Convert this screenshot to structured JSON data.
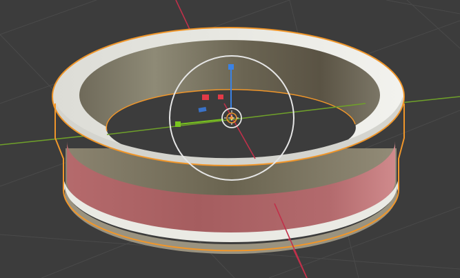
{
  "viewport": {
    "mode": "3d-viewport",
    "background": "#3c3c3c",
    "grid_color": "#4a4a4a",
    "x_axis_color": "#c1304a",
    "y_axis_color": "#6fa02a",
    "selection_outline_color": "#f0962a",
    "gizmo_ring_color": "#e6e6e6"
  },
  "object": {
    "type": "ring-mesh",
    "selected": true,
    "colors": {
      "rim_light": "#eeeeea",
      "inner_wall": "#8a8470",
      "outer_band": "#c27c7a",
      "groove": "#7e7761"
    }
  },
  "gizmo": {
    "icons": [
      "move-gizmo",
      "origin-dot",
      "z-arrow-handle",
      "y-arrow-handle",
      "x-plane-handles"
    ],
    "handle_colors": {
      "x": "#e23a47",
      "y": "#79c51f",
      "z": "#3a82e6"
    }
  },
  "labels": {
    "app": ""
  }
}
